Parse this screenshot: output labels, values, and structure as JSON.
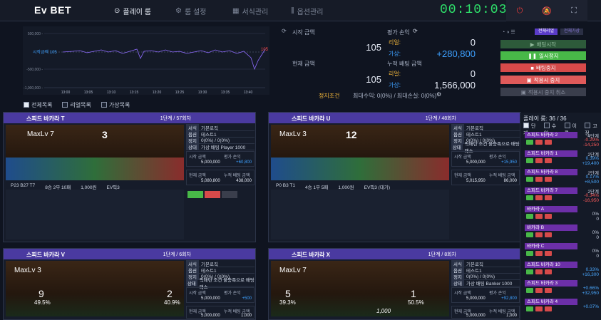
{
  "brand": {
    "logo": "Ev BET"
  },
  "nav": [
    {
      "label": "플레이 룸",
      "icon": "play-circle-icon"
    },
    {
      "label": "룸 설정",
      "icon": "gear-icon"
    },
    {
      "label": "서식관리",
      "icon": "grid-icon"
    },
    {
      "label": "옵션관리",
      "icon": "sliders-icon"
    }
  ],
  "clock": "00:10:03",
  "chart": {
    "y_ticks": [
      "500,000 -",
      "0",
      "-500,000 -",
      "-1,000,000 -"
    ],
    "start_label": "시작금액 105",
    "end_label": "105",
    "x_ticks": [
      "13:00",
      "13:05",
      "13:10",
      "13:15",
      "13:20",
      "13:25",
      "13:30",
      "13:35",
      "13:40"
    ]
  },
  "stats": {
    "start_label": "시작 금액",
    "start_value": "105",
    "current_label": "현재 금액",
    "current_value": "105",
    "eval_label": "평가 손익",
    "eval_real_label": "리얼:",
    "eval_real": "0",
    "eval_virtual_label": "가상:",
    "eval_virtual": "+280,800",
    "cum_label": "누적 배팅 금액",
    "cum_real_label": "리얼:",
    "cum_real": "0",
    "cum_virtual_label": "가상:",
    "cum_virtual": "1,566,000",
    "stop_label": "정지조건",
    "stop_text": "최대수익: 0(0%) / 최대손실: 0(0%)"
  },
  "controls": {
    "tab_real": "전체리얼",
    "tab_virtual": "전체가상",
    "start": "배팅시작",
    "pause": "일시정지",
    "stop": "배팅중지",
    "save_stop": "적용시 중지",
    "cancel": "적용시 중지 취소"
  },
  "filters": [
    "전체목록",
    "리얼목록",
    "가상목록"
  ],
  "cards": [
    {
      "title": "스피드 바카라 T",
      "step": "1단계 / 57회차",
      "mode": "가상",
      "level": "MaxLv 7",
      "count": "3",
      "formula": "기본로직",
      "option": "테스트1",
      "stop": "0(0%) / 0(0%)",
      "status": "가상 배팅 Player 1000",
      "bet_amount": "5,000,000",
      "eval": "+60,800",
      "cur_amount": "5,080,800",
      "cum": "438,000",
      "road": "P23 B27 T7",
      "round": "8승 2무 10패",
      "bet": "1,000원",
      "ev": "EV픽3"
    },
    {
      "title": "스피드 바카라 U",
      "step": "1단계 / 48회차",
      "mode": "가상",
      "level": "MaxLv 3",
      "count": "12",
      "formula": "기본로직",
      "option": "테스트1",
      "stop": "0(0%) / 0(0%)",
      "status": "픽패턴 조건 불충족으로 배팅패스",
      "bet_amount": "5,000,000",
      "eval": "+15,950",
      "cur_amount": "5,015,950",
      "cum": "86,000",
      "road": "P0 B3 T1",
      "round": "4승 1무 5패",
      "bet": "1,000원",
      "ev": "EV픽3 (대기)"
    },
    {
      "title": "스피드 바카라 V",
      "step": "1단계 / 6회차",
      "mode": "가상",
      "level": "MaxLv 3",
      "formula": "기본로직",
      "option": "테스트1",
      "stop": "0(0%) / 0(0%)",
      "status": "픽패턴 조건 불충족으로 배팅패스",
      "bet_amount": "5,000,000",
      "eval": "+500",
      "cur_amount": "5,000,000",
      "cum": "1,000",
      "left_score": "9",
      "left_pct": "49.5%",
      "right_score": "2",
      "right_pct": "40.9%"
    },
    {
      "title": "스피드 바카라 X",
      "step": "1단계 / 8회차",
      "mode": "가상",
      "level": "MaxLv 7",
      "formula": "기본로직",
      "option": "테스트1",
      "stop": "0(0%) / 0(0%)",
      "status": "가상 배팅 Banker 1000",
      "bet_amount": "5,000,000",
      "eval": "+92,800",
      "cur_amount": "5,000,000",
      "cum": "1,000",
      "left_score": "5",
      "left_pct": "39.3%",
      "right_score": "1",
      "right_pct": "50.5%",
      "bet_chip": "1,000"
    }
  ],
  "card_labels": {
    "formula": "서식",
    "option": "옵션",
    "stop": "정지",
    "status": "상태",
    "bet_amount": "시작 금액",
    "eval": "평가 손익",
    "cur": "현재 금액",
    "cum": "누적 배팅 금액",
    "virtual": "가상:",
    "real": "리얼:"
  },
  "sidebar": {
    "title": "플레이 룸: 36 / 36",
    "filters": [
      "단계",
      "수익",
      "이름",
      "고정"
    ],
    "rooms": [
      {
        "name": "스피드 바카라 2",
        "badge": "4단계",
        "a": "-0.29%",
        "b": "-14,250",
        "color": "#ff5a5a"
      },
      {
        "name": "스피드 바카라 1",
        "badge": "2단계",
        "a": "0.39%",
        "b": "+19,400",
        "color": "#4aa8ff"
      },
      {
        "name": "스피드 바카라 8",
        "badge": "2단계",
        "a": "0.17%",
        "b": "+8,500",
        "color": "#4aa8ff"
      },
      {
        "name": "스피드 바카라 7",
        "badge": "2단계",
        "a": "-0.34%",
        "b": "-16,950",
        "color": "#ff5a5a"
      },
      {
        "name": "바카라 A",
        "badge": "",
        "a": "0%",
        "b": "0",
        "color": "#c6cede"
      },
      {
        "name": "바카라 B",
        "badge": "",
        "a": "0%",
        "b": "0",
        "color": "#c6cede"
      },
      {
        "name": "바카라 C",
        "badge": "",
        "a": "0%",
        "b": "0",
        "color": "#c6cede"
      },
      {
        "name": "스피드 바카라 10",
        "badge": "",
        "a": "0.33%",
        "b": "+16,300",
        "color": "#4aa8ff"
      },
      {
        "name": "스피드 바카라 3",
        "badge": "",
        "a": "+0.66%",
        "b": "+32,950",
        "color": "#4aa8ff"
      },
      {
        "name": "스피드 바카라 4",
        "badge": "",
        "a": "+0.07%",
        "b": "",
        "color": "#4aa8ff"
      }
    ]
  }
}
